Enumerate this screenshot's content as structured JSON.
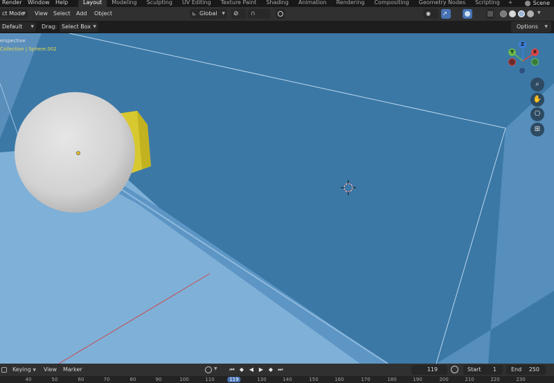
{
  "topbar": {
    "menus": [
      "Render",
      "Window",
      "Help"
    ],
    "tabs": [
      "Layout",
      "Modeling",
      "Sculpting",
      "UV Editing",
      "Texture Paint",
      "Shading",
      "Animation",
      "Rendering",
      "Compositing",
      "Geometry Nodes",
      "Scripting"
    ],
    "active_tab": "Layout",
    "add_tab": "+",
    "scene_label": "Scene"
  },
  "viewport_header": {
    "mode": "ct Mode",
    "menus": [
      "View",
      "Select",
      "Add",
      "Object"
    ],
    "orientation": "Global"
  },
  "tool_settings": {
    "orientation_value": "Default",
    "drag_label": "Drag:",
    "drag_value": "Select Box",
    "options_label": "Options"
  },
  "viewport": {
    "view_name": "erspective",
    "collection_text": "Collection | Sphere.002",
    "gizmo": {
      "z": "Z",
      "y": "Y",
      "x": "X"
    }
  },
  "timeline": {
    "keying_label": "Keying",
    "view_label": "View",
    "marker_label": "Marker",
    "current_frame": "119",
    "start_label": "Start",
    "start_value": "1",
    "end_label": "End",
    "end_value": "250"
  },
  "ruler": {
    "ticks": [
      "40",
      "50",
      "60",
      "70",
      "80",
      "90",
      "100",
      "110",
      "119",
      "130",
      "140",
      "150",
      "160",
      "170",
      "180",
      "190",
      "200",
      "210",
      "220",
      "230"
    ],
    "current": "119"
  },
  "colors": {
    "viewport_blue": "#3b78a6",
    "floor_light": "#7fb0d8",
    "selected_yellow": "#e8d84a",
    "accent_blue": "#4772b3"
  }
}
